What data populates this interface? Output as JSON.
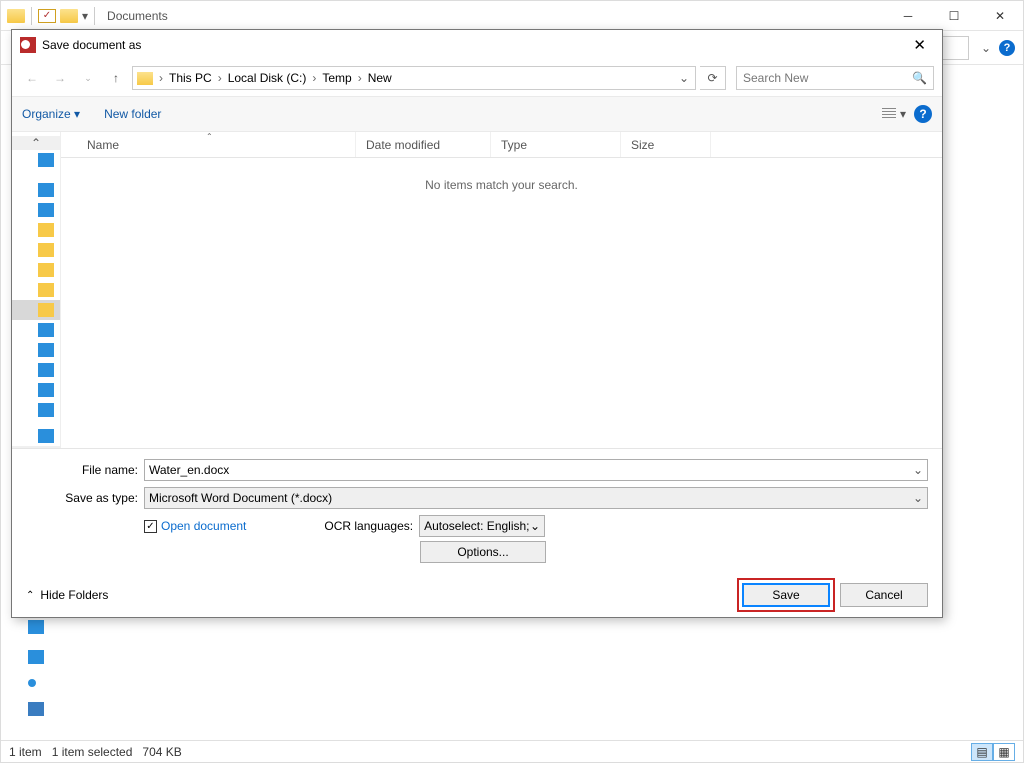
{
  "explorer": {
    "title": "Documents",
    "status": {
      "count": "1 item",
      "selection": "1 item selected",
      "size": "704 KB"
    }
  },
  "dialog": {
    "title": "Save document as",
    "breadcrumb": {
      "root": "This PC",
      "d1": "Local Disk (C:)",
      "d2": "Temp",
      "d3": "New"
    },
    "search_placeholder": "Search New",
    "toolbar": {
      "organize": "Organize",
      "new_folder": "New folder"
    },
    "columns": {
      "name": "Name",
      "date": "Date modified",
      "type": "Type",
      "size": "Size"
    },
    "empty_message": "No items match your search.",
    "fields": {
      "filename_label": "File name:",
      "filename_value": "Water_en.docx",
      "savetype_label": "Save as type:",
      "savetype_value": "Microsoft Word Document (*.docx)",
      "open_document": "Open document",
      "ocr_label": "OCR languages:",
      "ocr_value": "Autoselect: English; G",
      "options": "Options..."
    },
    "footer": {
      "hide_folders": "Hide Folders",
      "save": "Save",
      "cancel": "Cancel"
    }
  }
}
